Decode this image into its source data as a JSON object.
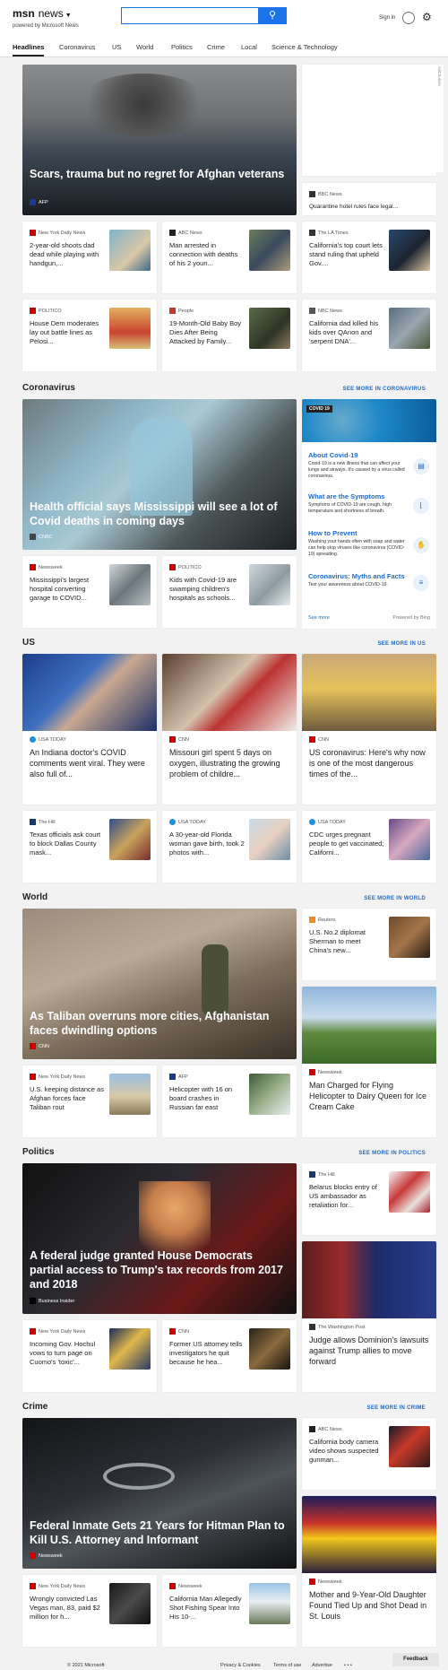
{
  "header": {
    "logo": "msn",
    "logo_section": "news",
    "powered_by": "powered by Microsoft News",
    "search_placeholder": "",
    "search_icon": "search-icon",
    "sign_in": "Sign in",
    "settings_icon": "gear-icon"
  },
  "nav": {
    "items": [
      "Headlines",
      "Coronavirus",
      "US",
      "World",
      "Politics",
      "Crime",
      "Local",
      "Science & Technology"
    ]
  },
  "headlines": {
    "hero": {
      "title": "Scars, trauma but no regret for Afghan veterans",
      "source": "AFP"
    },
    "side_top": {
      "source": "BBC News",
      "title": "Quarantine hotel rules face legal..."
    },
    "row1": [
      {
        "source": "New York Daily News",
        "title": "2-year-old shoots dad dead while playing with handgun,..."
      },
      {
        "source": "ABC News",
        "title": "Man arrested in connection with deaths of his 2 youn..."
      },
      {
        "source": "The LA Times",
        "title": "California's top court lets stand ruling that upheld Gov...."
      }
    ],
    "row2": [
      {
        "source": "POLITICO",
        "title": "House Dem moderates lay out battle lines as Pelosi..."
      },
      {
        "source": "People",
        "title": "19-Month-Old Baby Boy Dies After Being Attacked by Family..."
      },
      {
        "source": "NBC News",
        "title": "California dad killed his kids over QAnon and 'serpent DNA'..."
      }
    ],
    "ad_label": "AdChoices"
  },
  "coronavirus": {
    "title": "Coronavirus",
    "more": "SEE MORE IN CORONAVIRUS",
    "hero": {
      "title": "Health official says Mississippi will see a lot of Covid deaths in coming days",
      "source": "CNBC"
    },
    "cards": [
      {
        "source": "Newsweek",
        "title": "Mississippi's largest hospital converting garage to COVID..."
      },
      {
        "source": "POLITICO",
        "title": "Kids with Covid-19 are swamping children's hospitals as schools..."
      }
    ],
    "widget": {
      "badge": "COVID 19",
      "items": [
        {
          "heading": "About Covid-19",
          "text": "Covid-19 is a new illness that can affect your lungs and airways. It's caused by a virus called coronavirus."
        },
        {
          "heading": "What are the Symptoms",
          "text": "Symptoms of COVID-19 are cough, high temperature and shortness of breath."
        },
        {
          "heading": "How to Prevent",
          "text": "Washing your hands often with soap and water can help stop viruses like coronavirus (COVID-19) spreading."
        },
        {
          "heading": "Coronavirus: Myths and Facts",
          "text": "Test your awareness about COVID-19."
        }
      ],
      "see_more": "See more",
      "powered": "Powered by Bing"
    }
  },
  "us": {
    "title": "US",
    "more": "SEE MORE IN US",
    "top": [
      {
        "source": "USA TODAY",
        "title": "An Indiana doctor's COVID comments went viral. They were also full of..."
      },
      {
        "source": "CNN",
        "title": "Missouri girl spent 5 days on oxygen, illustrating the growing problem of childre..."
      },
      {
        "source": "CNN",
        "title": "US coronavirus: Here's why now is one of the most dangerous times of the..."
      }
    ],
    "bottom": [
      {
        "source": "The Hill",
        "title": "Texas officials ask court to block Dallas County mask..."
      },
      {
        "source": "USA TODAY",
        "title": "A 30-year-old Florida woman gave birth, took 2 photos with..."
      },
      {
        "source": "USA TODAY",
        "title": "CDC urges pregnant people to get vaccinated; Californi..."
      }
    ]
  },
  "world": {
    "title": "World",
    "more": "SEE MORE IN WORLD",
    "hero": {
      "title": "As Taliban overruns more cities, Afghanistan faces dwindling options",
      "source": "CNN"
    },
    "side_top": {
      "source": "Reuters",
      "title": "U.S. No.2 diplomat Sherman to meet China's new..."
    },
    "side_big": {
      "source": "Newsweek",
      "title": "Man Charged for Flying Helicopter to Dairy Queen for Ice Cream Cake"
    },
    "cards": [
      {
        "source": "New York Daily News",
        "title": "U.S. keeping distance as Afghan forces face Taliban rout"
      },
      {
        "source": "AFP",
        "title": "Helicopter with 16 on board crashes in Russian far east"
      }
    ]
  },
  "politics": {
    "title": "Politics",
    "more": "SEE MORE IN POLITICS",
    "hero": {
      "title": "A federal judge granted House Democrats partial access to Trump's tax records from 2017 and 2018",
      "source": "Business Insider"
    },
    "side_top": {
      "source": "The Hill",
      "title": "Belarus blocks entry of US ambassador as retaliation for..."
    },
    "side_big": {
      "source": "The Washington Post",
      "title": "Judge allows Dominion's lawsuits against Trump allies to move forward"
    },
    "cards": [
      {
        "source": "New York Daily News",
        "title": "Incoming Gov. Hochul vows to turn page on Cuomo's 'toxic'..."
      },
      {
        "source": "CNN",
        "title": "Former US attorney tells investigators he quit because he hea..."
      }
    ]
  },
  "crime": {
    "title": "Crime",
    "more": "SEE MORE IN CRIME",
    "hero": {
      "title": "Federal Inmate Gets 21 Years for Hitman Plan to Kill U.S. Attorney and Informant",
      "source": "Newsweek"
    },
    "side_top": {
      "source": "ABC News",
      "title": "California body camera video shows suspected gunman..."
    },
    "side_big": {
      "source": "Newsweek",
      "title": "Mother and 9-Year-Old Daughter Found Tied Up and Shot Dead in St. Louis"
    },
    "cards": [
      {
        "source": "New York Daily News",
        "title": "Wrongly convicted Las Vegas man, 83, paid $2 million for h..."
      },
      {
        "source": "Newsweek",
        "title": "California Man Allegedly Shot Fishing Spear Into His 10-..."
      }
    ]
  },
  "footer": {
    "copyright": "© 2021 Microsoft",
    "privacy": "Privacy & Cookies",
    "terms": "Terms of use",
    "advertise": "Advertise",
    "more": "• • •",
    "feedback": "Feedback"
  }
}
